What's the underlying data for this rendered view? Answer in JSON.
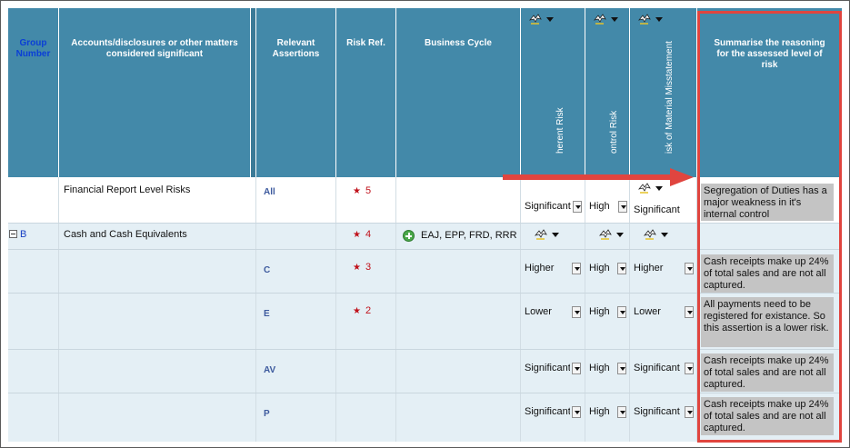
{
  "header": {
    "group_number": "Group Number",
    "accounts": "Accounts/disclosures or other matters considered significant",
    "assertions": "Relevant Assertions",
    "risk_ref": "Risk Ref.",
    "business_cycle": "Business Cycle",
    "inherent_risk": "herent Risk",
    "control_risk": "ontrol Risk",
    "material_misstatement": "isk of Material Misstatement",
    "summarise": "Summarise the reasoning for the assessed level of risk"
  },
  "rows": [
    {
      "group": "",
      "account": "Financial Report Level Risks",
      "assertion": "All",
      "risk_count": "5",
      "business_cycle": "",
      "inherent": "Significant",
      "control": "High",
      "rmm": "Significant",
      "summary": "Segregation of Duties has a major weakness in it's internal control"
    },
    {
      "group": "B",
      "account": "Cash and Cash Equivalents",
      "assertion": "",
      "risk_count": "4",
      "business_cycle": "EAJ, EPP, FRD, RRR",
      "inherent": "",
      "control": "",
      "rmm": "",
      "summary": ""
    },
    {
      "group": "",
      "account": "",
      "assertion": "C",
      "risk_count": "3",
      "business_cycle": "",
      "inherent": "Higher",
      "control": "High",
      "rmm": "Higher",
      "summary": "Cash receipts make up 24% of total sales and are not all captured."
    },
    {
      "group": "",
      "account": "",
      "assertion": "E",
      "risk_count": "2",
      "business_cycle": "",
      "inherent": "Lower",
      "control": "High",
      "rmm": "Lower",
      "summary": "All payments need to be registered for existance. So this assertion is a lower risk."
    },
    {
      "group": "",
      "account": "",
      "assertion": "AV",
      "risk_count": "",
      "business_cycle": "",
      "inherent": "Significant",
      "control": "High",
      "rmm": "Significant",
      "summary": "Cash receipts make up 24% of total sales and are not all captured."
    },
    {
      "group": "",
      "account": "",
      "assertion": "P",
      "risk_count": "",
      "business_cycle": "",
      "inherent": "Significant",
      "control": "High",
      "rmm": "Significant",
      "summary": "Cash receipts make up 24% of total sales and are not all captured."
    }
  ],
  "icons": {
    "risk_star": "star-icon",
    "bolt": "lightning-icon",
    "add": "plus-circle-icon",
    "collapse": "minus-box-icon"
  },
  "colors": {
    "header_bg": "#4389a9",
    "highlight": "#e0453f",
    "note_bg": "#c4c4c4",
    "risk_red": "#c0121b"
  }
}
